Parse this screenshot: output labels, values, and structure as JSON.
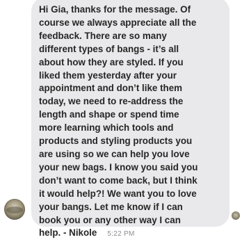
{
  "message": {
    "text": "Hi Gia, thanks for the message. Of\ncourse we always appreciate all the\nfeedback. There are so many\ndifferent types of bangs - it’s all\nabout how they are styled. If you\nliked them yesterday after your\nappointment and don’t like them\ntoday, we need to re-address the\nlength and shape or spend time\nmore learning which tools and\nproducts and styling products you\nare using so we can help you love\nyour new bags. I know you said you\ndon’t want to come back, but I think\nit would help?! We want you to love\nyour bangs. Let me know if I can\nbook you or any other way I can\nhelp. - Nikole",
    "bubble_color": "#e9e9eb",
    "text_color": "#262626"
  },
  "sender": {
    "avatar_icon": "profile-avatar"
  },
  "read_receipt": {
    "avatar_icon": "seen-avatar"
  },
  "timestamp": "5:22 PM"
}
